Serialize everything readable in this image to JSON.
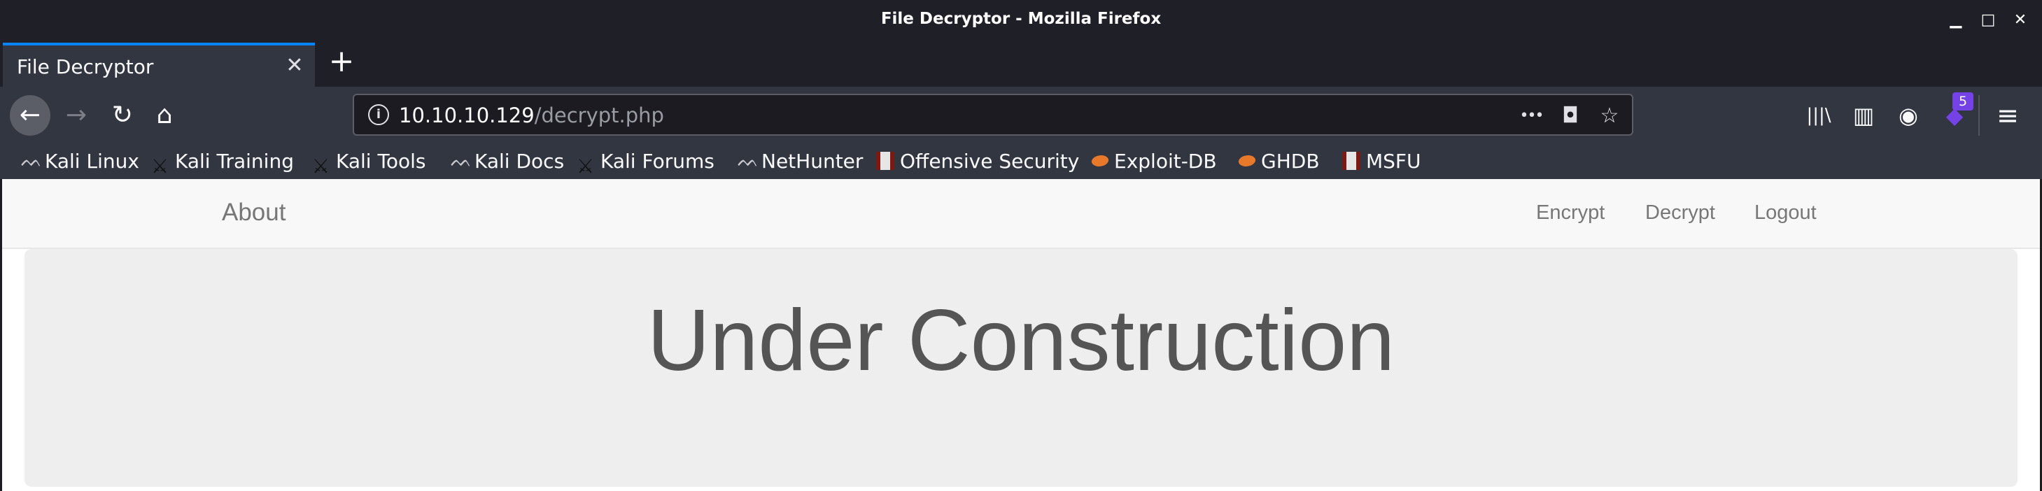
{
  "window": {
    "title": "File Decryptor - Mozilla Firefox",
    "minimize": "▁",
    "maximize": "□",
    "close": "✕"
  },
  "tabs": [
    {
      "label": "File Decryptor",
      "close": "✕"
    }
  ],
  "newtab_label": "+",
  "toolbar": {
    "back": "←",
    "forward": "→",
    "reload": "↻",
    "home": "⌂",
    "url_host": "10.10.10.129",
    "url_path": "/decrypt.php",
    "info": "i",
    "more": "•••",
    "pocket": "◘",
    "star": "☆",
    "library": "|||\\",
    "sidebar": "▥",
    "account": "◉",
    "extension_badge": "5",
    "menu": "≡"
  },
  "bookmarks": [
    {
      "label": "Kali Linux",
      "icon": "kali-dragon-icon"
    },
    {
      "label": "Kali Training",
      "icon": "kali-sword-icon"
    },
    {
      "label": "Kali Tools",
      "icon": "kali-sword-icon"
    },
    {
      "label": "Kali Docs",
      "icon": "kali-dragon-icon"
    },
    {
      "label": "Kali Forums",
      "icon": "kali-sword-icon"
    },
    {
      "label": "NetHunter",
      "icon": "kali-dragon-icon"
    },
    {
      "label": "Offensive Security",
      "icon": "offsec-icon"
    },
    {
      "label": "Exploit-DB",
      "icon": "exploit-db-icon"
    },
    {
      "label": "GHDB",
      "icon": "exploit-db-icon"
    },
    {
      "label": "MSFU",
      "icon": "msfu-icon"
    }
  ],
  "site": {
    "brand": "About",
    "nav": [
      "Encrypt",
      "Decrypt",
      "Logout"
    ],
    "heading": "Under Construction"
  },
  "colors": {
    "accent": "#0a84ff",
    "toolbar": "#323640",
    "titlebar": "#1f2027",
    "page_nav": "#f8f8f8",
    "jumbotron": "#eeeeee",
    "heading": "#555555"
  }
}
